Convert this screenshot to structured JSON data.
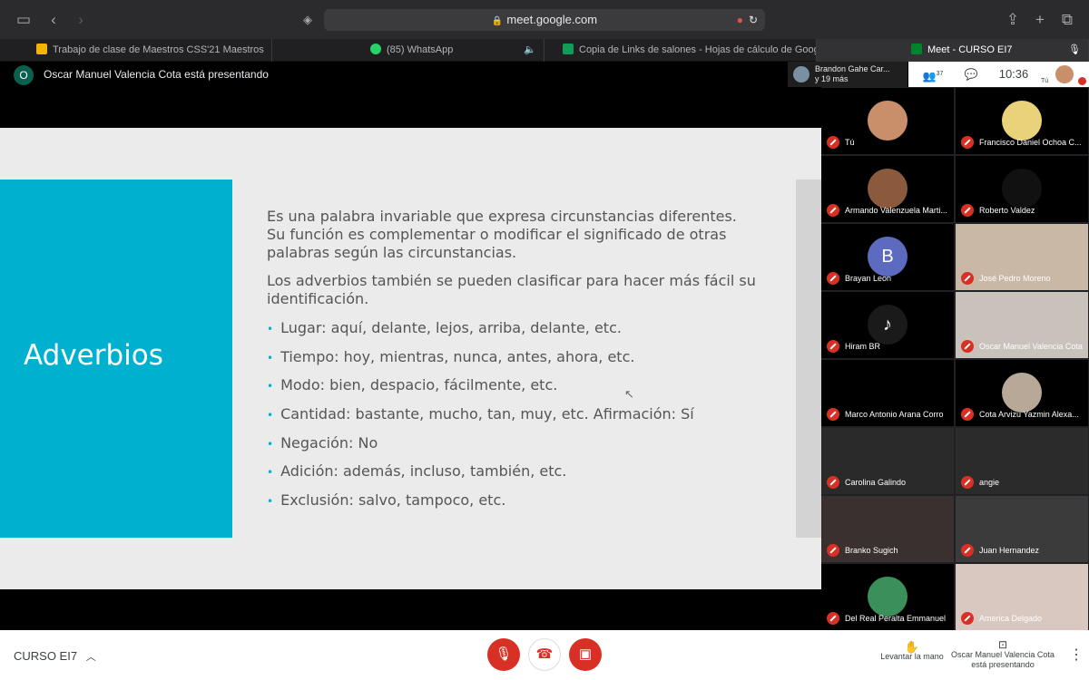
{
  "browser": {
    "url": "meet.google.com",
    "tabs": [
      {
        "label": "Trabajo de clase de Maestros CSS'21 Maestros",
        "color": "#f5b400"
      },
      {
        "label": "(85) WhatsApp",
        "color": "#25d366"
      },
      {
        "label": "Copia de Links de salones - Hojas de cálculo de Google",
        "color": "#0f9d58"
      },
      {
        "label": "Meet - CURSO EI7",
        "color": "#00832d"
      }
    ]
  },
  "presenter": {
    "initial": "O",
    "banner": "Oscar Manuel Valencia Cota está presentando",
    "chip_line1": "Brandon Gahe Car...",
    "chip_line2": "y 19 más"
  },
  "meet_header": {
    "participants_count": "37",
    "time": "10:36",
    "self_label": "Tú"
  },
  "slide": {
    "title": "Adverbios",
    "paragraph1": "Es una palabra invariable que expresa circunstancias diferentes. Su función es complementar o modificar el significado de otras palabras según las circunstancias.",
    "paragraph2": "Los adverbios también se pueden clasificar para hacer más fácil su identificación.",
    "bullets": [
      "Lugar: aquí, delante, lejos, arriba, delante, etc.",
      "Tiempo: hoy, mientras, nunca, antes, ahora, etc.",
      "Modo: bien, despacio, fácilmente, etc.",
      "Cantidad: bastante, mucho, tan, muy, etc.  Afirmación: Sí",
      "Negación: No",
      "Adición: además, incluso, también, etc.",
      "Exclusión: salvo, tampoco, etc."
    ],
    "colors": {
      "accent": "#00b1cf",
      "background": "#ebebeb"
    }
  },
  "participants": [
    {
      "name": "Tú",
      "avatar": "#c98e6a",
      "initial": ""
    },
    {
      "name": "Francisco Daniel Ochoa C...",
      "avatar": "#e9d27a",
      "initial": ""
    },
    {
      "name": "Armando Valenzuela Marti...",
      "avatar": "#8b5a3c",
      "initial": ""
    },
    {
      "name": "Roberto Valdez",
      "avatar": "#111111",
      "initial": ""
    },
    {
      "name": "Brayan Leon",
      "avatar": "#5c6bc0",
      "initial": "B"
    },
    {
      "name": "José Pedro Moreno",
      "avatar": "",
      "initial": ""
    },
    {
      "name": "Hiram BR",
      "avatar": "#1a1a1a",
      "initial": "♪"
    },
    {
      "name": "Oscar Manuel Valencia Cota",
      "avatar": "",
      "initial": ""
    },
    {
      "name": "Marco Antonio Arana Corro",
      "avatar": "",
      "initial": ""
    },
    {
      "name": "Cota Arvizu Yazmin Alexa...",
      "avatar": "#b8a898",
      "initial": ""
    },
    {
      "name": "Carolina Galindo",
      "avatar": "",
      "initial": ""
    },
    {
      "name": "angie",
      "avatar": "",
      "initial": ""
    },
    {
      "name": "Branko Sugich",
      "avatar": "",
      "initial": ""
    },
    {
      "name": "Juan Hernandez",
      "avatar": "",
      "initial": ""
    },
    {
      "name": "Del Real Peralta Emmanuel",
      "avatar": "#3a8f5a",
      "initial": ""
    },
    {
      "name": "America Delgado",
      "avatar": "",
      "initial": ""
    }
  ],
  "bottom": {
    "meeting_name": "CURSO EI7",
    "raise_hand": "Levantar la mano",
    "presenting_line1": "Oscar Manuel Valencia Cota",
    "presenting_line2": "está presentando"
  }
}
